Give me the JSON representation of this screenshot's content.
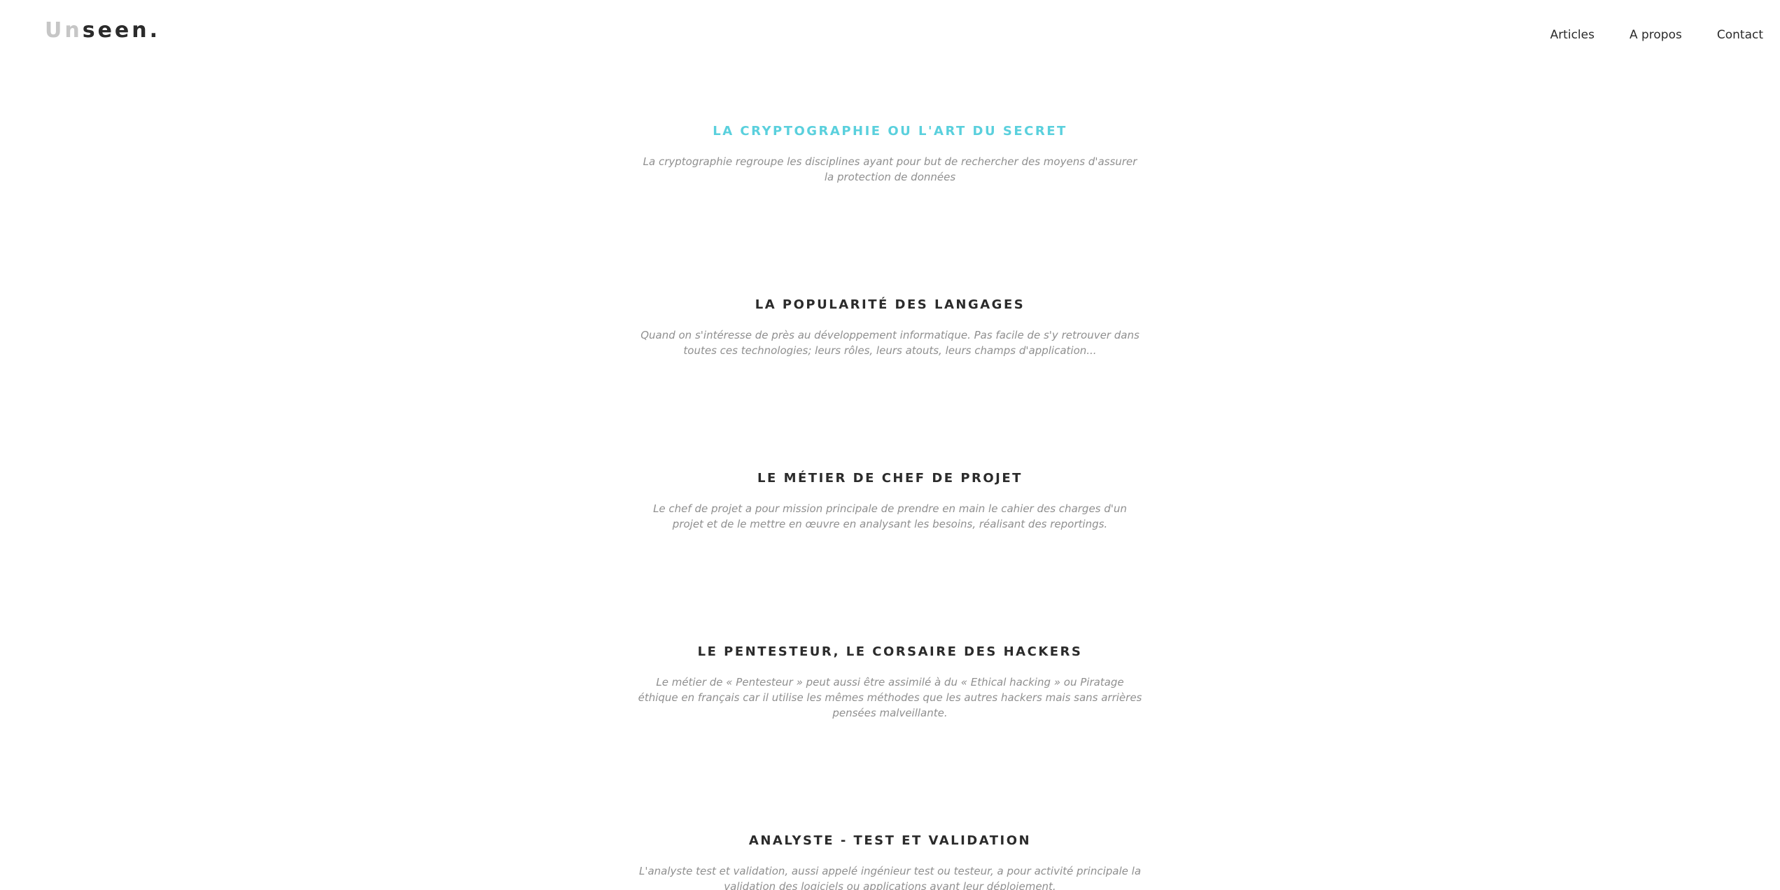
{
  "header": {
    "logo": {
      "light_part": "Un",
      "dark_part": "seen."
    },
    "nav": [
      {
        "label": "Articles"
      },
      {
        "label": "A propos"
      },
      {
        "label": "Contact"
      }
    ]
  },
  "articles": [
    {
      "title": "LA CRYPTOGRAPHIE OU L'ART DU SECRET",
      "excerpt": "La cryptographie regroupe les disciplines ayant pour but de rechercher des moyens d'assurer la protection de données"
    },
    {
      "title": "LA POPULARITÉ DES LANGAGES",
      "excerpt": "Quand on s'intéresse de près au développement informatique. Pas facile de s'y retrouver dans toutes ces technologies; leurs rôles, leurs atouts, leurs champs d'application..."
    },
    {
      "title": "LE MÉTIER DE CHEF DE PROJET",
      "excerpt": "Le chef de projet a pour mission principale de prendre en main le cahier des charges d'un projet et de le mettre en œuvre en analysant les besoins, réalisant des reportings."
    },
    {
      "title": "LE PENTESTEUR, LE CORSAIRE DES HACKERS",
      "excerpt": "Le métier de « Pentesteur » peut aussi être assimilé à du « Ethical hacking » ou Piratage éthique en français car il utilise les mêmes méthodes que les autres hackers mais sans arrières pensées malveillante."
    },
    {
      "title": "ANALYSTE - TEST ET VALIDATION",
      "excerpt": "L'analyste test et validation, aussi appelé ingénieur test ou testeur, a pour activité principale la validation des logiciels ou applications avant leur déploiement."
    }
  ],
  "colors": {
    "accent": "#5ad0dd",
    "title": "#2b2b2b",
    "excerpt": "#8f8f8f",
    "logo_light": "#c6c6c6"
  }
}
